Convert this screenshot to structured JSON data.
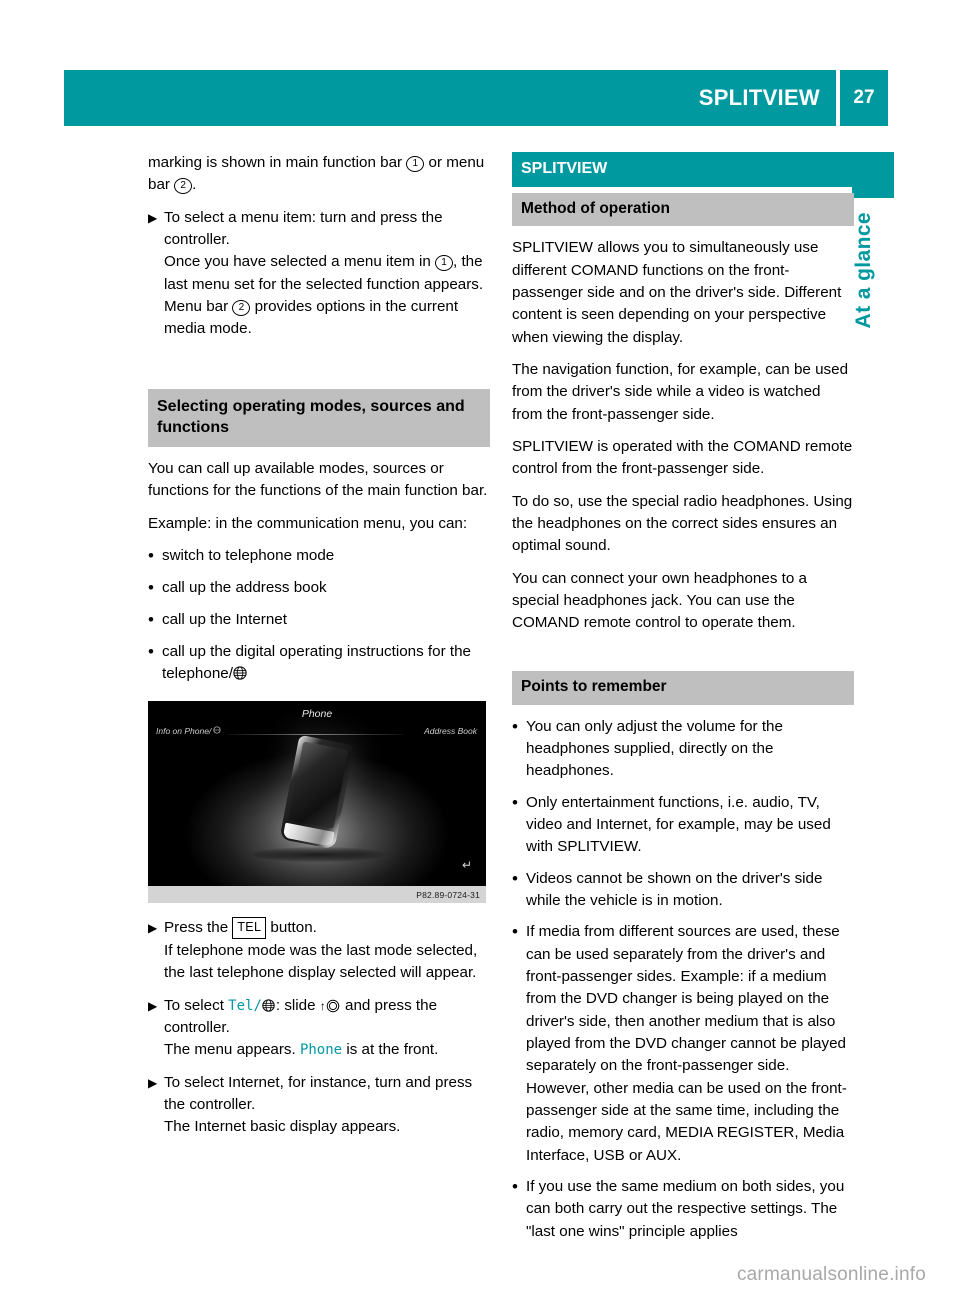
{
  "header": {
    "title": "SPLITVIEW",
    "page_number": "27",
    "accent_color": "#0099a0"
  },
  "side_tab": {
    "label": "At a glance"
  },
  "left_column": {
    "intro_para": {
      "before_one": "marking is shown in main function bar ",
      "marker_one": "1",
      "between": " or menu bar ",
      "marker_two": "2",
      "after": "."
    },
    "steps": [
      {
        "marker": "▶",
        "lines": [
          "To select a menu item: turn and press the controller."
        ],
        "sub_with_markers": {
          "before": "Once you have selected a menu item in ",
          "marker": "1",
          "after": ", the last menu set for the selected function appears."
        },
        "sub2_with_markers": {
          "before": "Menu bar ",
          "marker": "2",
          "after": " provides options in the current media mode."
        }
      }
    ],
    "section_heading": "Selecting operating modes, sources and functions",
    "body_para_1": "You can call up available modes, sources or functions for the functions of the main function bar.",
    "body_para_2": "Example: in the communication menu, you can:",
    "bullets": [
      {
        "marker": "R",
        "text": "switch to telephone mode"
      },
      {
        "marker": "R",
        "text": "call up the address book"
      },
      {
        "marker": "R",
        "text": "call up the Internet"
      },
      {
        "marker": "R",
        "text": "call up the digital operating instructions for the telephone/",
        "has_globe_icon": true
      }
    ],
    "figure": {
      "screen_title": "Phone",
      "left_label": "Info on Phone/",
      "right_label": "Address Book",
      "caption": "P82.89-0724-31",
      "back_icon": "↵"
    },
    "steps_after_figure": [
      {
        "marker": "▶",
        "before_key": "Press the ",
        "keycap": "TEL",
        "after_key": " button.",
        "sub": "If telephone mode was the last mode selected, the last telephone display selected will appear."
      },
      {
        "marker": "▶",
        "before_token": "To select ",
        "token": "Tel/",
        "after_token": ": slide ",
        "arrow": "↑",
        "after_arrow": " and press the controller.",
        "sub_before": "The menu appears. ",
        "sub_token": "Phone",
        "sub_after": " is at the front."
      },
      {
        "marker": "▶",
        "text": "To select Internet, for instance, turn and press the controller.",
        "sub": "The Internet basic display appears."
      }
    ]
  },
  "right_column": {
    "title_heading": "SPLITVIEW",
    "method_heading": "Method of operation",
    "method_paragraphs": [
      "SPLITVIEW allows you to simultaneously use different COMAND functions on the front-passenger side and on the driver's side. Different content is seen depending on your perspective when viewing the display.",
      "The navigation function, for example, can be used from the driver's side while a video is watched from the front-passenger side.",
      "SPLITVIEW is operated with the COMAND remote control from the front-passenger side.",
      "To do so, use the special radio headphones. Using the headphones on the correct sides ensures an optimal sound.",
      "You can connect your own headphones to a special headphones jack. You can use the COMAND remote control to operate them."
    ],
    "points_heading": "Points to remember",
    "points": [
      {
        "marker": "R",
        "text": "You can only adjust the volume for the headphones supplied, directly on the headphones."
      },
      {
        "marker": "R",
        "text": "Only entertainment functions, i.e. audio, TV, video and Internet, for example, may be used with SPLITVIEW."
      },
      {
        "marker": "R",
        "text": "Videos cannot be shown on the driver's side while the vehicle is in motion."
      },
      {
        "marker": "R",
        "text": "If media from different sources are used, these can be used separately from the driver's and front-passenger sides. Example: if a medium from the DVD changer is being played on the driver's side, then another medium that is also played from the DVD changer cannot be played separately on the front-passenger side. However, other media can be used on the front-passenger side at the same time, including the radio, memory card, MEDIA REGISTER, Media Interface, USB or AUX."
      },
      {
        "marker": "R",
        "text": "If you use the same medium on both sides, you can both carry out the respective settings. The \"last one wins\" principle applies"
      }
    ]
  },
  "watermark": {
    "text": "carmanualsonline.info"
  }
}
